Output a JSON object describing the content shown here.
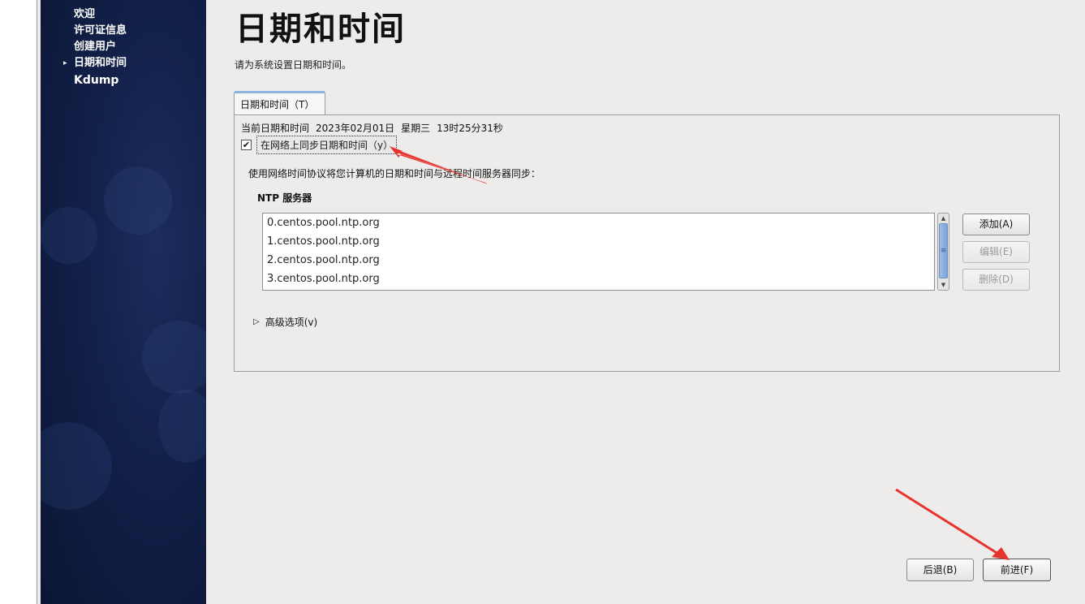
{
  "sidebar": {
    "items": [
      {
        "label": "欢迎",
        "current": false
      },
      {
        "label": "许可证信息",
        "current": false
      },
      {
        "label": "创建用户",
        "current": false
      },
      {
        "label": "日期和时间",
        "current": true
      },
      {
        "label": "Kdump",
        "current": false
      }
    ],
    "current_marker": "▸"
  },
  "header": {
    "title": "日期和时间",
    "subtitle": "请为系统设置日期和时间。"
  },
  "tab": {
    "label": "日期和时间（T）"
  },
  "datetime": {
    "current_label": "当前日期和时间",
    "date": "2023年02月01日",
    "weekday": "星期三",
    "time": "13时25分31秒"
  },
  "sync": {
    "checked": true,
    "check_glyph": "✔",
    "label": "在网络上同步日期和时间（y）",
    "description": "使用网络时间协议将您计算机的日期和时间与远程时间服务器同步："
  },
  "ntp": {
    "title": "NTP 服务器",
    "servers": [
      "0.centos.pool.ntp.org",
      "1.centos.pool.ntp.org",
      "2.centos.pool.ntp.org",
      "3.centos.pool.ntp.org"
    ],
    "add_label": "添加(A)",
    "edit_label": "编辑(E)",
    "delete_label": "删除(D)"
  },
  "advanced": {
    "label": "高级选项(v)",
    "expanded": false
  },
  "footer": {
    "back_label": "后退(B)",
    "forward_label": "前进(F)"
  },
  "colors": {
    "sidebar_bg": "#122049",
    "annotation_arrow": "#e8322e",
    "scroll_thumb": "#7ca2d6"
  }
}
